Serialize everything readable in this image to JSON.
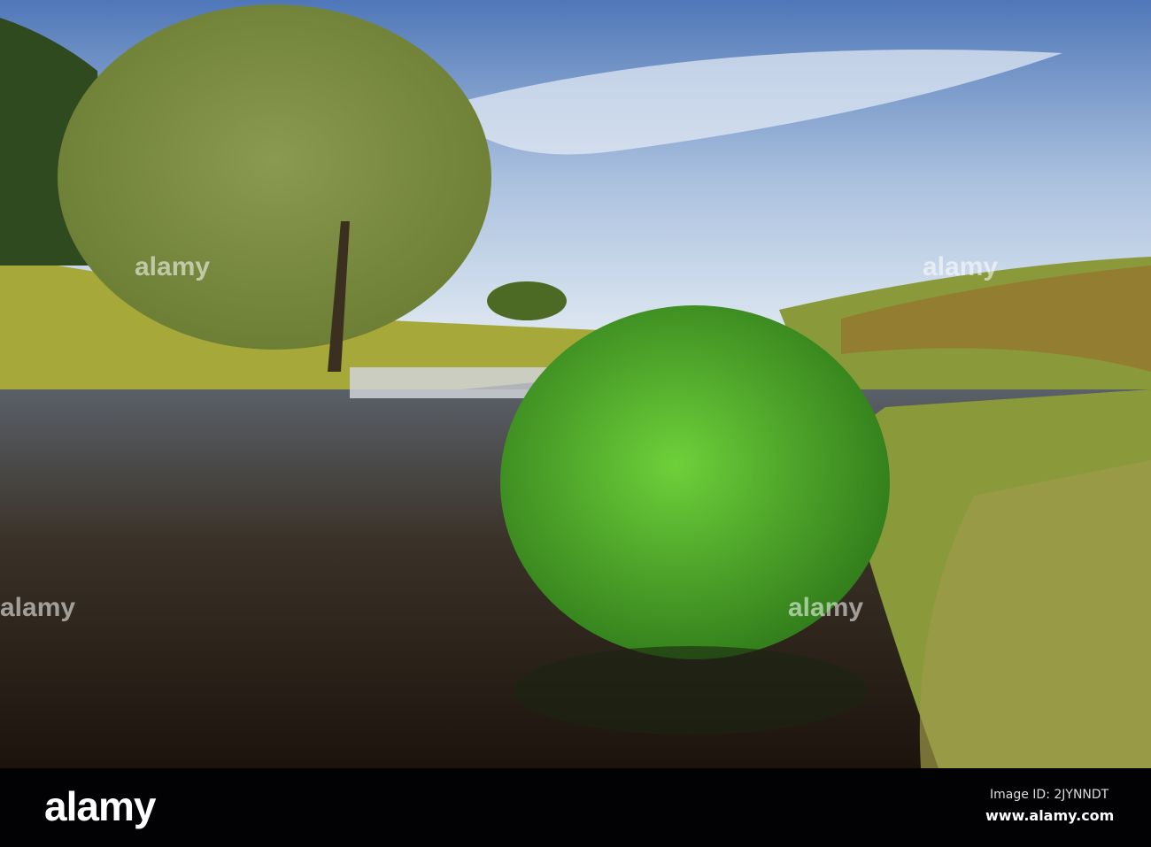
{
  "photo": {
    "subject": "River with small weir, tree and green shrub",
    "watermark_text": "alamy"
  },
  "footer": {
    "logo": "alamy",
    "image_id": "Image ID: 2JYNNDT",
    "url": "www.alamy.com"
  }
}
